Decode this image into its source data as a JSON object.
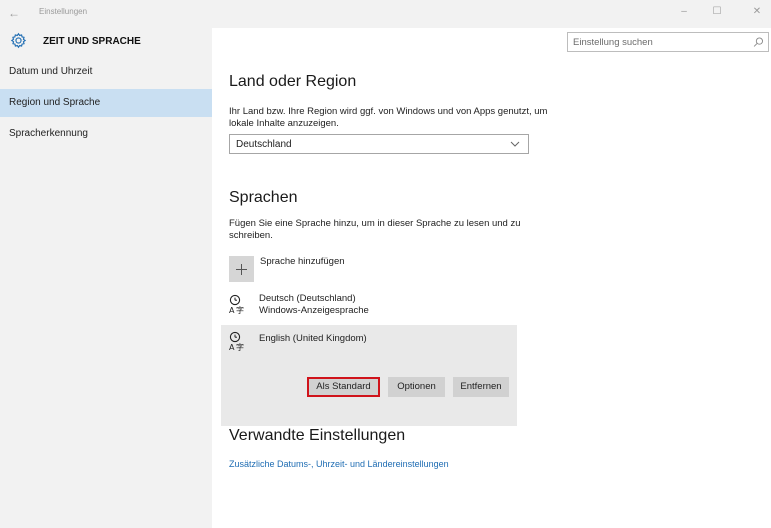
{
  "window": {
    "app_title": "Einstellungen",
    "back_glyph": "←",
    "minimize_glyph": "–",
    "maximize_glyph": "☐",
    "close_glyph": "✕"
  },
  "sidebar": {
    "section_icon": "gear-icon",
    "section_title": "ZEIT UND SPRACHE",
    "items": [
      {
        "label": "Datum und Uhrzeit",
        "selected": false
      },
      {
        "label": "Region und Sprache",
        "selected": true
      },
      {
        "label": "Spracherkennung",
        "selected": false
      }
    ]
  },
  "search": {
    "placeholder": "Einstellung suchen",
    "icon": "search-icon"
  },
  "region": {
    "heading": "Land oder Region",
    "description": "Ihr Land bzw. Ihre Region wird ggf. von Windows und von Apps genutzt, um lokale Inhalte anzuzeigen.",
    "selected_value": "Deutschland"
  },
  "languages": {
    "heading": "Sprachen",
    "description": "Fügen Sie eine Sprache hinzu, um in dieser Sprache zu lesen und zu schreiben.",
    "add_label": "Sprache hinzufügen",
    "items": [
      {
        "name": "Deutsch (Deutschland)",
        "subtitle": "Windows-Anzeigesprache",
        "icon": "language-icon"
      },
      {
        "name": "English (United Kingdom)",
        "subtitle": "",
        "icon": "language-icon"
      }
    ],
    "buttons": {
      "set_default": "Als Standard",
      "options": "Optionen",
      "remove": "Entfernen"
    }
  },
  "related": {
    "heading": "Verwandte Einstellungen",
    "link": "Zusätzliche Datums-, Uhrzeit- und Ländereinstellungen"
  },
  "colors": {
    "selected_nav": "#c9dff2",
    "link": "#1f6db3",
    "highlight_border": "#d0131b",
    "sidebar_bg": "#f2f2f2",
    "selected_language_bg": "#e9e9e9"
  }
}
